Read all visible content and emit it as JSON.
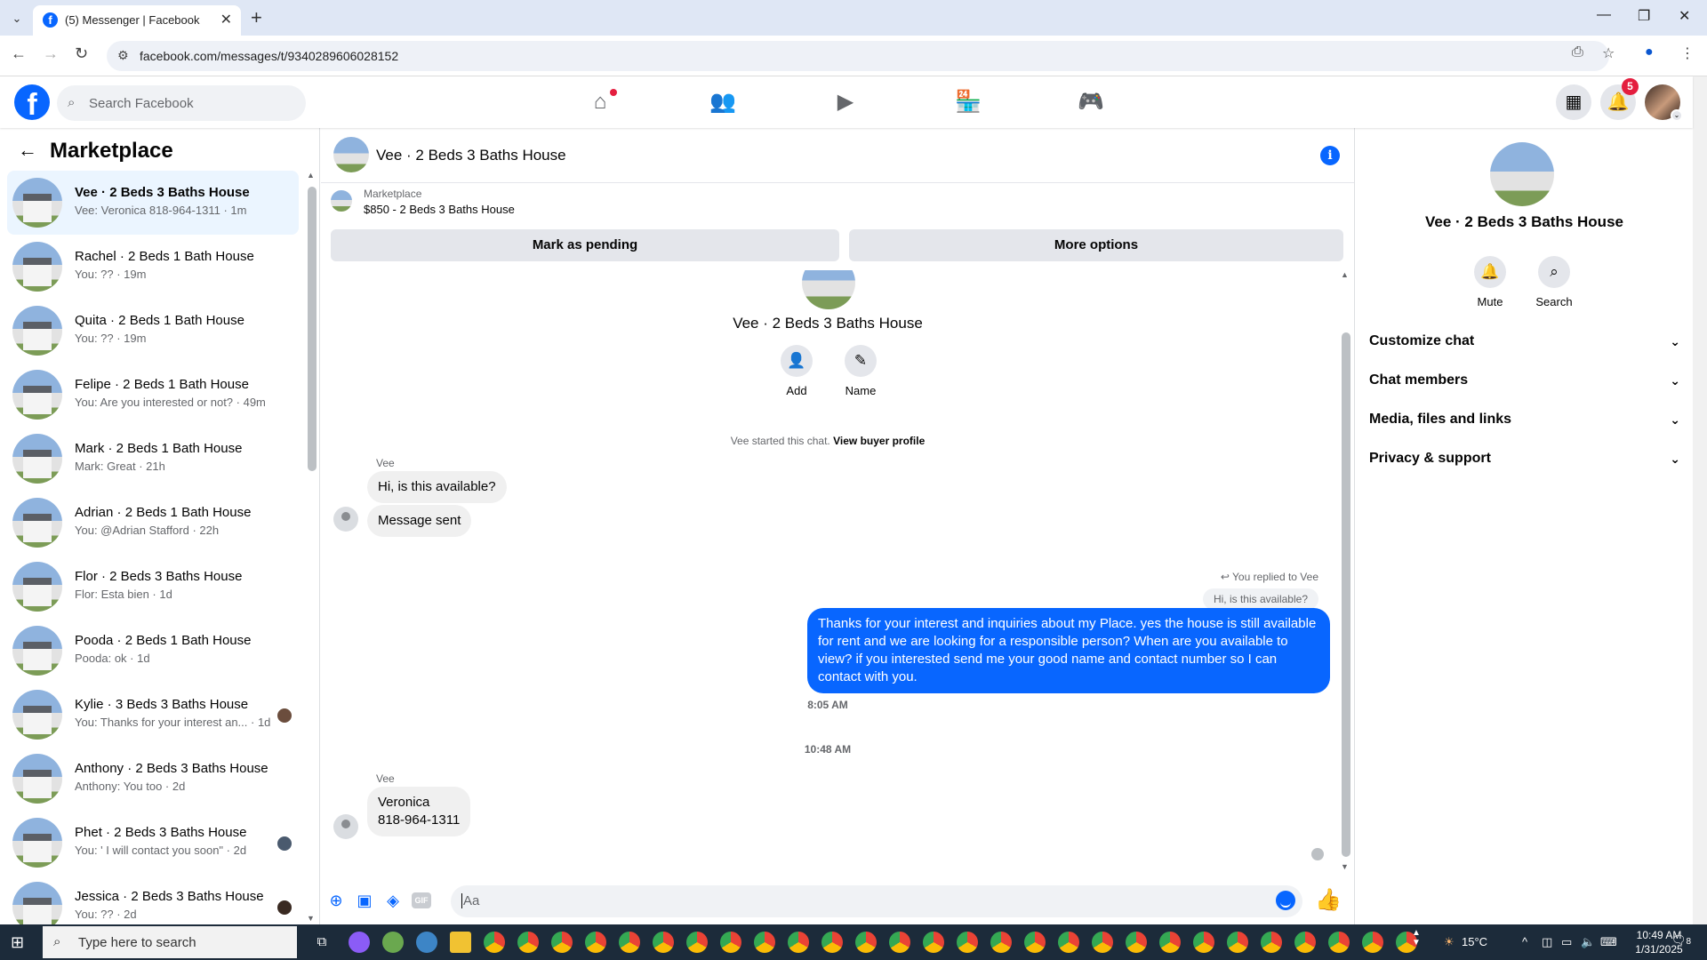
{
  "browser": {
    "tab_title": "(5) Messenger | Facebook",
    "url": "facebook.com/messages/t/9340289606028152"
  },
  "header": {
    "search_placeholder": "Search Facebook",
    "notification_count": "5"
  },
  "sidebar": {
    "title": "Marketplace",
    "conversations": [
      {
        "name": "Vee · 2 Beds 3 Baths House",
        "preview": "Vee: Veronica 818-964-1311 · 1m"
      },
      {
        "name": "Rachel · 2 Beds 1 Bath House",
        "preview": "You: ?? · 19m"
      },
      {
        "name": "Quita · 2 Beds 1 Bath House",
        "preview": "You: ?? · 19m"
      },
      {
        "name": "Felipe · 2 Beds 1 Bath House",
        "preview": "You: Are you interested or not? · 49m"
      },
      {
        "name": "Mark · 2 Beds 1 Bath House",
        "preview": "Mark: Great · 21h"
      },
      {
        "name": "Adrian · 2 Beds 1 Bath House",
        "preview": "You: @Adrian Stafford · 22h"
      },
      {
        "name": "Flor · 2 Beds 3 Baths House",
        "preview": "Flor: Esta bien · 1d"
      },
      {
        "name": "Pooda · 2 Beds 1 Bath House",
        "preview": "Pooda: ok · 1d"
      },
      {
        "name": "Kylie · 3 Beds 3 Baths House",
        "preview": "You: Thanks for your interest an... · 1d"
      },
      {
        "name": "Anthony · 2 Beds 3 Baths House",
        "preview": "Anthony: You too · 2d"
      },
      {
        "name": "Phet · 2 Beds 3 Baths House",
        "preview": "You: ' I will contact you soon\" · 2d"
      },
      {
        "name": "Jessica · 2 Beds 3 Baths House",
        "preview": "You: ?? · 2d"
      }
    ]
  },
  "chat": {
    "title": "Vee · 2 Beds 3 Baths House",
    "marketplace_label": "Marketplace",
    "listing": "$850 - 2 Beds 3 Baths House",
    "mark_pending": "Mark as pending",
    "more_options": "More options",
    "intro_name": "Vee · 2 Beds 3 Baths House",
    "add_label": "Add",
    "name_label": "Name",
    "started_text": "Vee started this chat.",
    "view_profile": "View buyer profile",
    "sender1": "Vee",
    "msg1": "Hi, is this available?",
    "msg2": "Message sent",
    "time1": "8:05 AM",
    "replied_to": "You replied to Vee",
    "quoted": "Hi, is this available?",
    "outgoing": "Thanks for your interest and inquiries about my Place. yes the house is still available for rent and we are looking for a responsible person? When are you available to view? if you interested send me your good name and contact number  so I can contact with you.",
    "time2": "10:48 AM",
    "sender2": "Vee",
    "msg3_line1": "Veronica",
    "msg3_line2": "818-964-1311",
    "composer_placeholder": "Aa"
  },
  "details": {
    "name": "Vee · 2 Beds 3 Baths House",
    "mute": "Mute",
    "search": "Search",
    "sections": [
      "Customize chat",
      "Chat members",
      "Media, files and links",
      "Privacy & support"
    ]
  },
  "taskbar": {
    "search_placeholder": "Type here to search",
    "temperature": "15°C",
    "time": "10:49 AM",
    "date": "1/31/2025",
    "notif": "8"
  }
}
